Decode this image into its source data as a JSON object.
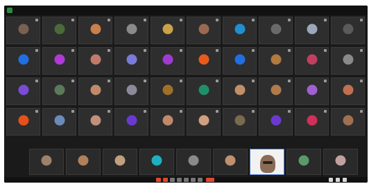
{
  "window": {
    "title": ""
  },
  "status": {
    "left_text": ""
  },
  "colors": {
    "accent": "#2d8c3c",
    "alert": "#e0482e"
  },
  "grid": {
    "rows": [
      [
        {
          "name": "",
          "color": "#7a6050"
        },
        {
          "name": "",
          "color": "#4a6a3a"
        },
        {
          "name": "",
          "color": "#c9804a"
        },
        {
          "name": "",
          "color": "#8a8a8a"
        },
        {
          "name": "",
          "color": "#caa24a"
        },
        {
          "name": "",
          "color": "#9a6a50"
        },
        {
          "name": "",
          "color": "#1f8fcf"
        },
        {
          "name": "",
          "color": "#6a6a6a"
        },
        {
          "name": "",
          "color": "#9aa8b8"
        },
        {
          "name": "",
          "color": "#5a5a5a"
        }
      ],
      [
        {
          "name": "",
          "color": "#1f6fe0"
        },
        {
          "name": "",
          "color": "#b03ad8"
        },
        {
          "name": "",
          "color": "#c07a6a"
        },
        {
          "name": "",
          "color": "#7a7ad8"
        },
        {
          "name": "",
          "color": "#a03ad0"
        },
        {
          "name": "",
          "color": "#e85a1a"
        },
        {
          "name": "",
          "color": "#1f6fe0"
        },
        {
          "name": "",
          "color": "#b07a40"
        },
        {
          "name": "",
          "color": "#c04060"
        },
        {
          "name": "",
          "color": "#8a8a8a"
        }
      ],
      [
        {
          "name": "",
          "color": "#7a4ad8"
        },
        {
          "name": "",
          "color": "#5a7a5a"
        },
        {
          "name": "",
          "color": "#c08a6a"
        },
        {
          "name": "",
          "color": "#8a8a9a"
        },
        {
          "name": "",
          "color": "#a0702a"
        },
        {
          "name": "",
          "color": "#1f8f6a"
        },
        {
          "name": "",
          "color": "#c0906a"
        },
        {
          "name": "",
          "color": "#b07a4a"
        },
        {
          "name": "",
          "color": "#a060d0"
        },
        {
          "name": "",
          "color": "#c07050"
        }
      ],
      [
        {
          "name": "",
          "color": "#e8501a"
        },
        {
          "name": "",
          "color": "#6a8ab8"
        },
        {
          "name": "",
          "color": "#c0907a"
        },
        {
          "name": "",
          "color": "#6a3ad0"
        },
        {
          "name": "",
          "color": "#c08a6a"
        },
        {
          "name": "",
          "color": "#d0a080"
        },
        {
          "name": "",
          "color": "#7a6a50"
        },
        {
          "name": "",
          "color": "#6a3ad0"
        },
        {
          "name": "",
          "color": "#d0305a"
        },
        {
          "name": "",
          "color": "#a07050"
        }
      ]
    ]
  },
  "bottom_row": [
    {
      "name": "",
      "color": "#a0806a",
      "active": false
    },
    {
      "name": "",
      "color": "#b0805a",
      "active": false
    },
    {
      "name": "",
      "color": "#c0a080",
      "active": false
    },
    {
      "name": "",
      "color": "#1fb0c0",
      "active": false
    },
    {
      "name": "",
      "color": "#8a8a8a",
      "active": false
    },
    {
      "name": "",
      "color": "#c09070",
      "active": false
    },
    {
      "name": "",
      "color": "#8a6b55",
      "active": true
    },
    {
      "name": "",
      "color": "#5a9a6a",
      "active": false
    },
    {
      "name": "",
      "color": "#c0a0a0",
      "active": false
    }
  ],
  "controls": [
    {
      "icon": "mic-icon",
      "color": "#e0482e"
    },
    {
      "icon": "video-icon",
      "color": "#e0482e"
    },
    {
      "icon": "share-screen-icon",
      "color": "#777777"
    },
    {
      "icon": "participants-icon",
      "color": "#777777"
    },
    {
      "icon": "chat-icon",
      "color": "#777777"
    },
    {
      "icon": "reactions-icon",
      "color": "#777777"
    },
    {
      "icon": "more-icon",
      "color": "#777777"
    },
    {
      "icon": "leave-icon",
      "color": "#e0482e"
    }
  ],
  "right_controls": [
    {
      "icon": "layout-icon"
    },
    {
      "icon": "pip-icon"
    },
    {
      "icon": "fullscreen-icon"
    }
  ]
}
